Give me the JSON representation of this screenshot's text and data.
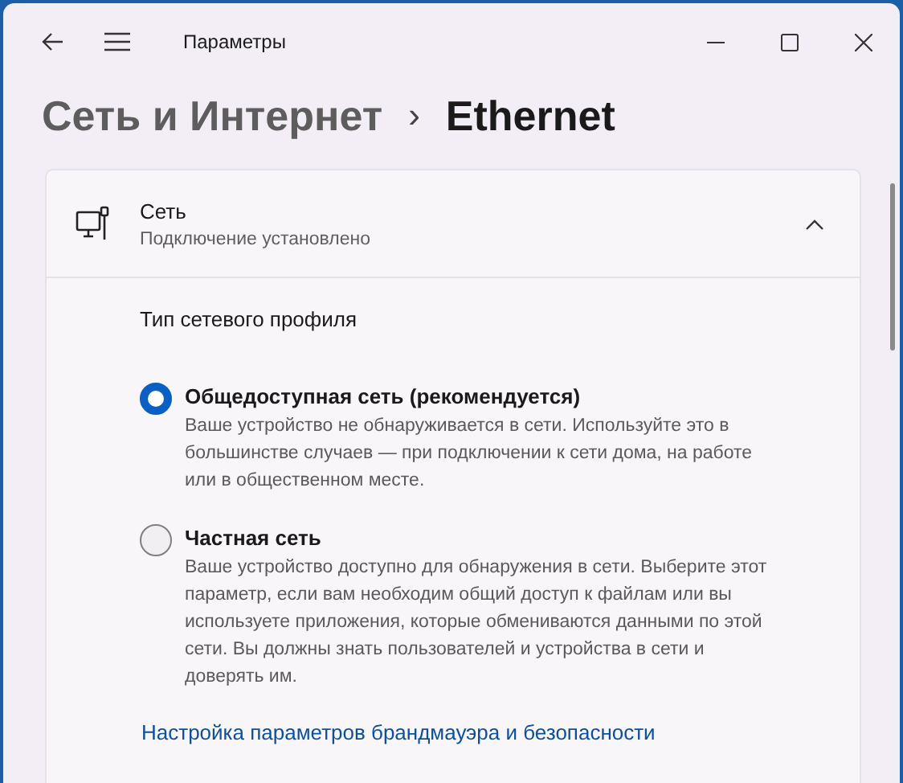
{
  "window": {
    "title": "Параметры"
  },
  "breadcrumb": {
    "parent": "Сеть и Интернет",
    "separator": "›",
    "current": "Ethernet"
  },
  "card": {
    "title": "Сеть",
    "subtitle": "Подключение установлено",
    "expanded": true
  },
  "profile": {
    "heading": "Тип сетевого профиля",
    "options": [
      {
        "label": "Общедоступная сеть (рекомендуется)",
        "description": "Ваше устройство не обнаруживается в сети. Используйте это в большинстве случаев — при подключении к сети дома, на работе или в общественном месте.",
        "selected": true
      },
      {
        "label": "Частная сеть",
        "description": "Ваше устройство доступно для обнаружения в сети. Выберите этот параметр, если вам необходим общий доступ к файлам или вы используете приложения, которые обмениваются данными по этой сети. Вы должны знать пользователей и устройства в сети и доверять им.",
        "selected": false
      }
    ]
  },
  "link": "Настройка параметров брандмауэра и безопасности"
}
